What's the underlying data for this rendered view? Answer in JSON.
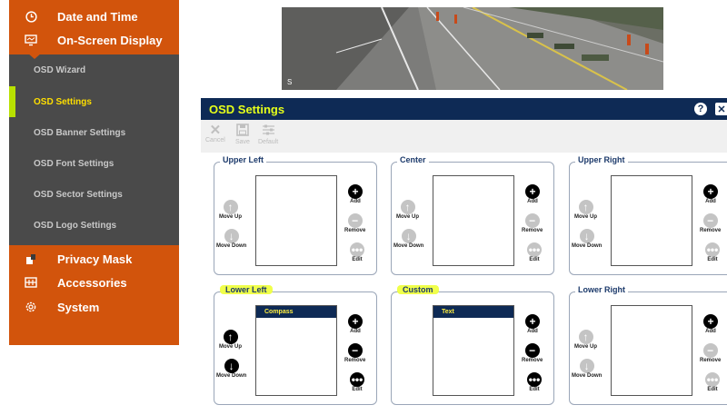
{
  "sidebar": {
    "date_time": "Date and Time",
    "on_screen_display": "On-Screen Display",
    "sub_items": [
      {
        "label": "OSD Wizard"
      },
      {
        "label": "OSD Settings"
      },
      {
        "label": "OSD Banner Settings"
      },
      {
        "label": "OSD Font Settings"
      },
      {
        "label": "OSD Sector Settings"
      },
      {
        "label": "OSD Logo Settings"
      }
    ],
    "privacy_mask": "Privacy Mask",
    "accessories": "Accessories",
    "system": "System"
  },
  "video": {
    "label": "S"
  },
  "panel": {
    "title": "OSD Settings",
    "help_glyph": "?",
    "close_glyph": "✕",
    "toolbar": {
      "cancel": "Cancel",
      "save": "Save",
      "default": "Default"
    },
    "buttons": {
      "move_up": "Move Up",
      "move_down": "Move Down",
      "add": "Add",
      "remove": "Remove",
      "edit": "Edit"
    },
    "groups": [
      {
        "title": "Upper Left",
        "items": []
      },
      {
        "title": "Center",
        "items": []
      },
      {
        "title": "Upper Right",
        "items": []
      },
      {
        "title": "Lower Left",
        "items": [
          "Compass"
        ]
      },
      {
        "title": "Custom",
        "items": [
          "Text"
        ]
      },
      {
        "title": "Lower Right",
        "items": []
      }
    ]
  },
  "colors": {
    "accent_orange": "#d2540c",
    "sidebar_bg": "#4a4a4a",
    "titlebar_navy": "#0e2a55",
    "highlight_yellow": "#f0ff4a",
    "active_green": "#b8e000"
  }
}
